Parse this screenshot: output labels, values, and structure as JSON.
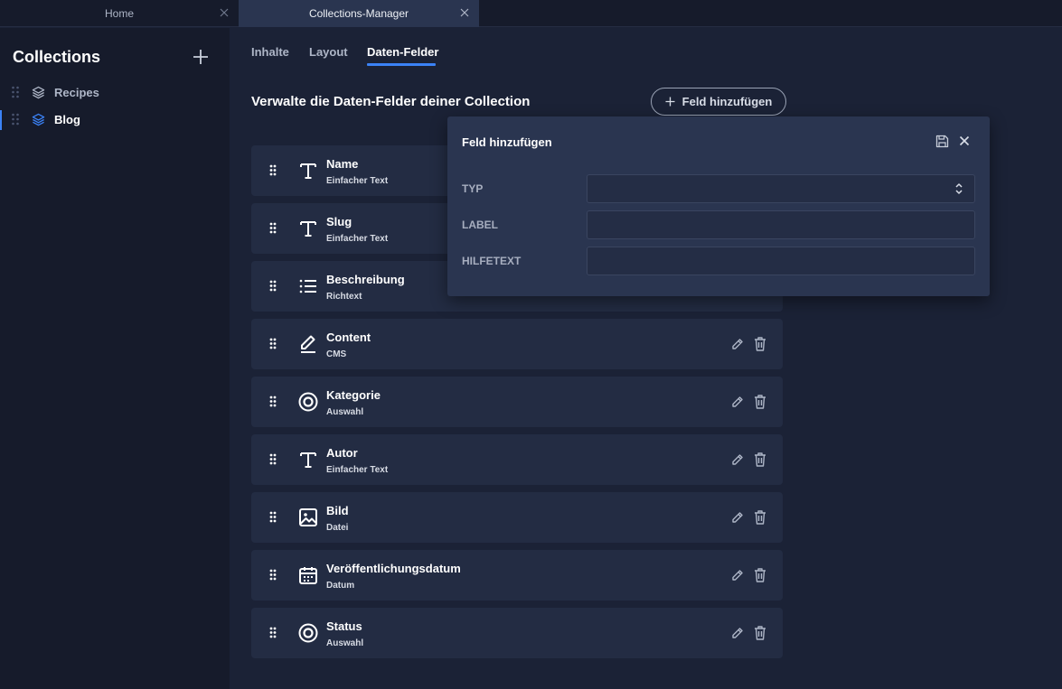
{
  "window_tabs": [
    {
      "label": "Home"
    },
    {
      "label": "Collections-Manager"
    }
  ],
  "sidebar": {
    "title": "Collections",
    "items": [
      {
        "label": "Recipes",
        "active": false
      },
      {
        "label": "Blog",
        "active": true
      }
    ]
  },
  "main": {
    "tabs": [
      {
        "label": "Inhalte"
      },
      {
        "label": "Layout"
      },
      {
        "label": "Daten-Felder",
        "active": true
      }
    ],
    "heading": "Verwalte die Daten-Felder deiner Collection",
    "add_button_label": "Feld hinzufügen",
    "fields": [
      {
        "name": "Name",
        "type": "Einfacher Text",
        "icon": "text-icon"
      },
      {
        "name": "Slug",
        "type": "Einfacher Text",
        "icon": "text-icon"
      },
      {
        "name": "Beschreibung",
        "type": "Richtext",
        "icon": "list-icon"
      },
      {
        "name": "Content",
        "type": "CMS",
        "icon": "pen-icon"
      },
      {
        "name": "Kategorie",
        "type": "Auswahl",
        "icon": "radio-target-icon"
      },
      {
        "name": "Autor",
        "type": "Einfacher Text",
        "icon": "text-icon"
      },
      {
        "name": "Bild",
        "type": "Datei",
        "icon": "image-icon"
      },
      {
        "name": "Veröffentlichungsdatum",
        "type": "Datum",
        "icon": "calendar-icon"
      },
      {
        "name": "Status",
        "type": "Auswahl",
        "icon": "radio-target-icon"
      }
    ]
  },
  "popup": {
    "title": "Feld hinzufügen",
    "rows": [
      {
        "label": "TYP",
        "value": ""
      },
      {
        "label": "LABEL",
        "value": ""
      },
      {
        "label": "HILFETEXT",
        "value": ""
      }
    ]
  },
  "colors": {
    "background": "#1b2236",
    "sidebar": "#161b2b",
    "card": "#232c43",
    "accent": "#3b82f6"
  }
}
